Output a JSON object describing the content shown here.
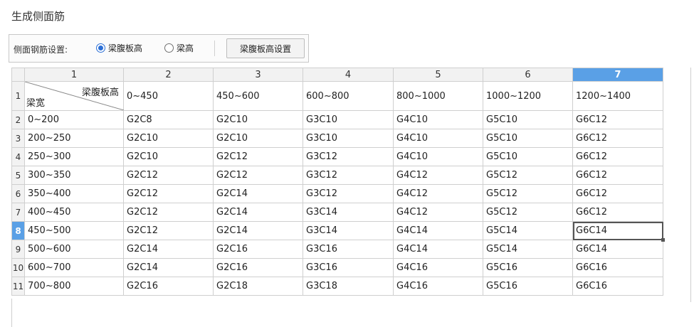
{
  "title": "生成侧面筋",
  "toolbar": {
    "label": "侧面钢筋设置:",
    "option1": "梁腹板高",
    "option2": "梁高",
    "button": "梁腹板高设置"
  },
  "table": {
    "col_headers": [
      "1",
      "2",
      "3",
      "4",
      "5",
      "6",
      "7"
    ],
    "corner_top": "梁腹板高",
    "corner_bottom": "梁宽",
    "row1": [
      "0~450",
      "450~600",
      "600~800",
      "800~1000",
      "1000~1200",
      "1200~1400"
    ],
    "rows": [
      {
        "n": "2",
        "cells": [
          "0~200",
          "G2C8",
          "G2C10",
          "G3C10",
          "G4C10",
          "G5C10",
          "G6C12"
        ]
      },
      {
        "n": "3",
        "cells": [
          "200~250",
          "G2C10",
          "G2C10",
          "G3C10",
          "G4C10",
          "G5C10",
          "G6C12"
        ]
      },
      {
        "n": "4",
        "cells": [
          "250~300",
          "G2C10",
          "G2C12",
          "G3C12",
          "G4C10",
          "G5C10",
          "G6C12"
        ]
      },
      {
        "n": "5",
        "cells": [
          "300~350",
          "G2C12",
          "G2C12",
          "G3C12",
          "G4C12",
          "G5C12",
          "G6C12"
        ]
      },
      {
        "n": "6",
        "cells": [
          "350~400",
          "G2C12",
          "G2C14",
          "G3C12",
          "G4C12",
          "G5C12",
          "G6C12"
        ]
      },
      {
        "n": "7",
        "cells": [
          "400~450",
          "G2C12",
          "G2C14",
          "G3C14",
          "G4C12",
          "G5C12",
          "G6C12"
        ]
      },
      {
        "n": "8",
        "cells": [
          "450~500",
          "G2C12",
          "G2C14",
          "G3C14",
          "G4C14",
          "G5C14",
          "G6C14"
        ]
      },
      {
        "n": "9",
        "cells": [
          "500~600",
          "G2C14",
          "G2C16",
          "G3C16",
          "G4C14",
          "G5C14",
          "G6C14"
        ]
      },
      {
        "n": "10",
        "cells": [
          "600~700",
          "G2C14",
          "G2C16",
          "G3C16",
          "G4C16",
          "G5C16",
          "G6C16"
        ]
      },
      {
        "n": "11",
        "cells": [
          "700~800",
          "G2C16",
          "G2C18",
          "G3C18",
          "G4C16",
          "G5C16",
          "G6C16"
        ]
      }
    ]
  },
  "colors": {
    "accent": "#5aa0e6",
    "radio": "#2b6fd6"
  }
}
